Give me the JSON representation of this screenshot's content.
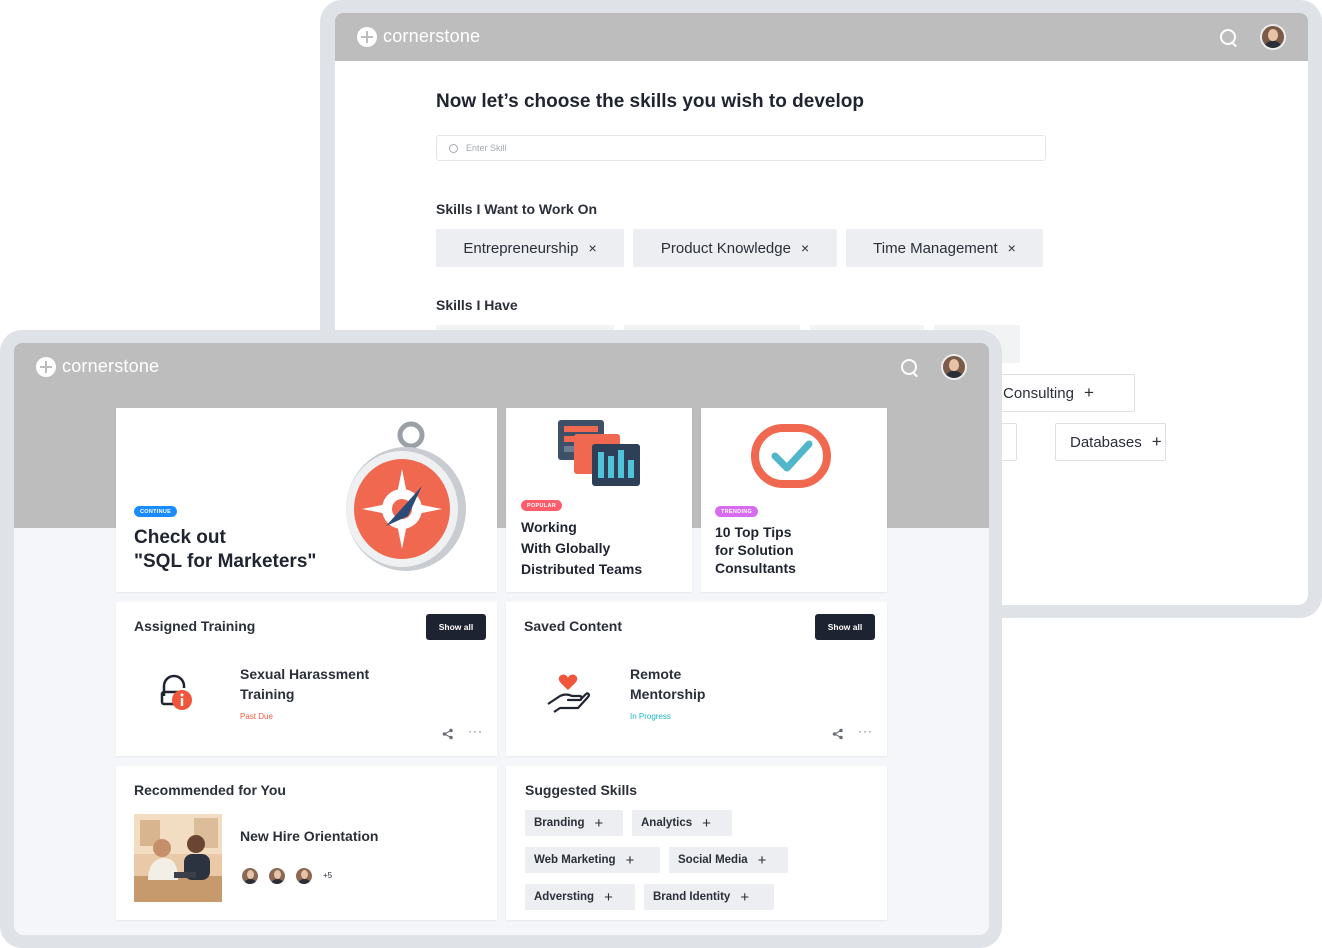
{
  "back_window": {
    "logo": "cornerstone",
    "heading": "Now let’s choose the skills you wish to develop",
    "search_placeholder": "Enter Skill",
    "want_heading": "Skills I Want to Work On",
    "want_skills": [
      "Entrepreneurship",
      "Product Knowledge",
      "Time Management"
    ],
    "have_heading": "Skills I Have",
    "have_visible": [
      "T Consulting",
      "Databases"
    ],
    "remove_symbol": "×",
    "add_symbol": "+"
  },
  "front_window": {
    "logo": "cornerstone",
    "hero": {
      "badge": "CONTINUE",
      "title_line1": "Check out",
      "title_line2": "\"SQL for Marketers\"",
      "badge_color": "#1a8cff"
    },
    "popular": {
      "badge": "POPULAR",
      "title_lines": [
        "Working",
        "With Globally",
        "Distributed Teams"
      ],
      "badge_color": "#ff5c6c"
    },
    "trending": {
      "badge": "TRENDING",
      "title_lines": [
        "10 Top Tips",
        "for Solution",
        "Consultants"
      ],
      "badge_color": "#d86cf0"
    },
    "assigned": {
      "title": "Assigned Training",
      "show_all": "Show all",
      "item_lines": [
        "Sexual Harassment",
        "Training"
      ],
      "status": "Past Due",
      "status_color": "#f05a3c"
    },
    "saved": {
      "title": "Saved Content",
      "show_all": "Show all",
      "item_lines": [
        "Remote",
        "Mentorship"
      ],
      "status": "In Progress",
      "status_color": "#1fb5c9"
    },
    "recommended": {
      "title": "Recommended for You",
      "item": "New Hire Orientation",
      "more_count": "+5"
    },
    "suggested": {
      "title": "Suggested Skills",
      "skills": [
        "Branding",
        "Analytics",
        "Web Marketing",
        "Social Media",
        "Adversting",
        "Brand Identity"
      ]
    },
    "more_symbol": "···",
    "add_symbol": "+"
  }
}
